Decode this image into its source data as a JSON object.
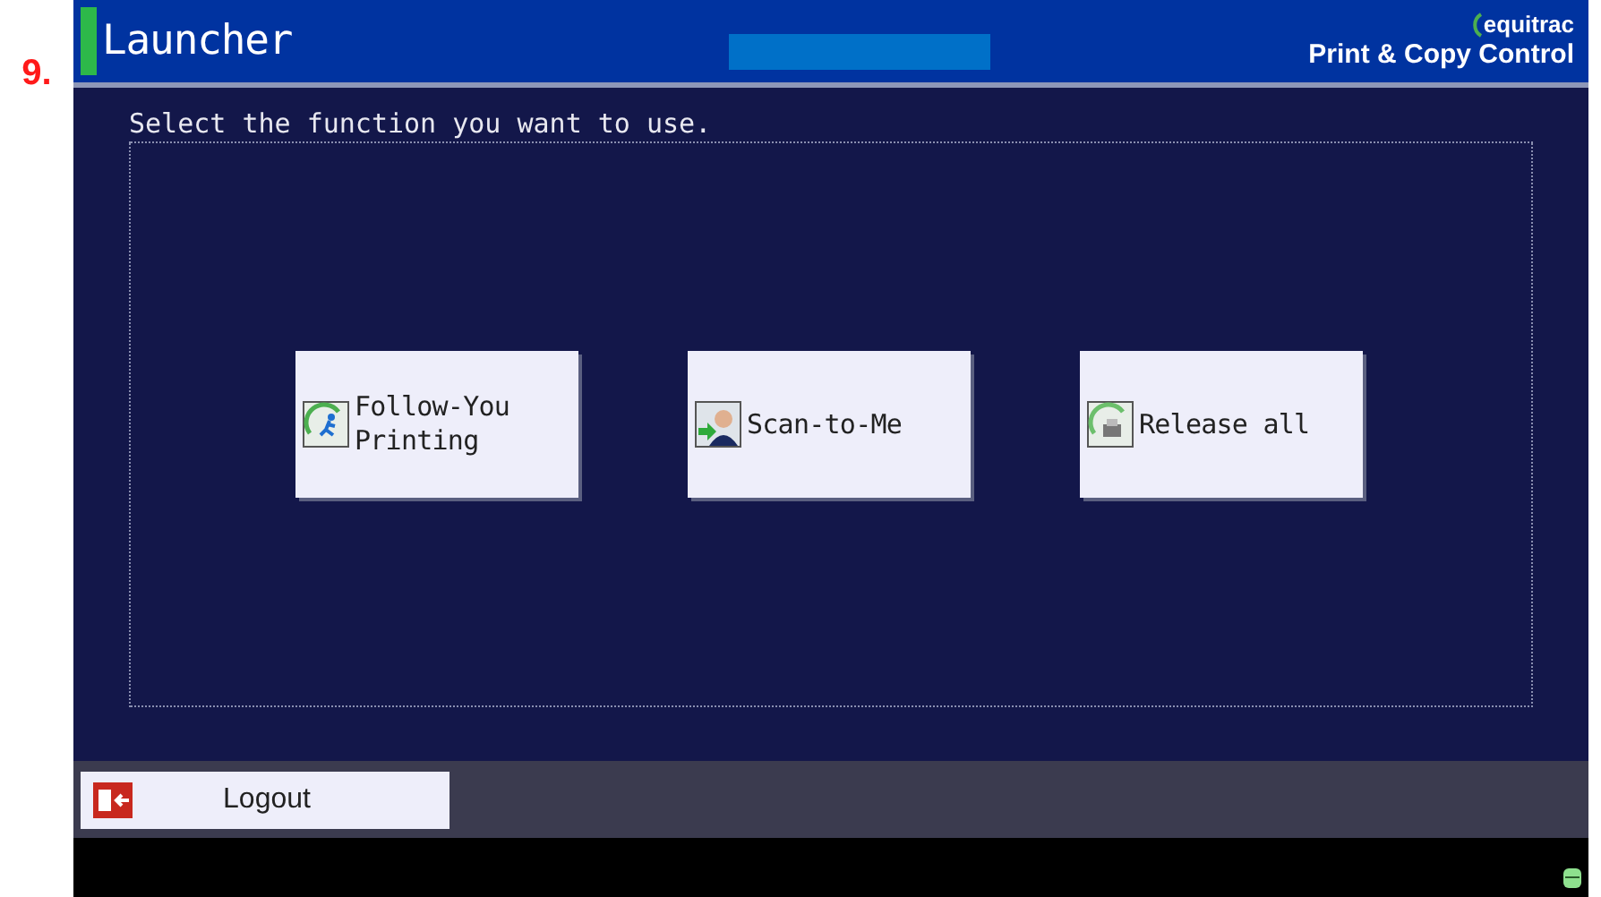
{
  "figure_label": "9.",
  "header": {
    "title": "Launcher",
    "brand": "equitrac",
    "product": "Print & Copy Control"
  },
  "prompt": "Select the function you want to use.",
  "functions": [
    {
      "kind": "follow",
      "label": "Follow-You\nPrinting"
    },
    {
      "kind": "scan",
      "label": "Scan-to-Me"
    },
    {
      "kind": "release",
      "label": "Release all"
    }
  ],
  "footer": {
    "logout": "Logout"
  }
}
